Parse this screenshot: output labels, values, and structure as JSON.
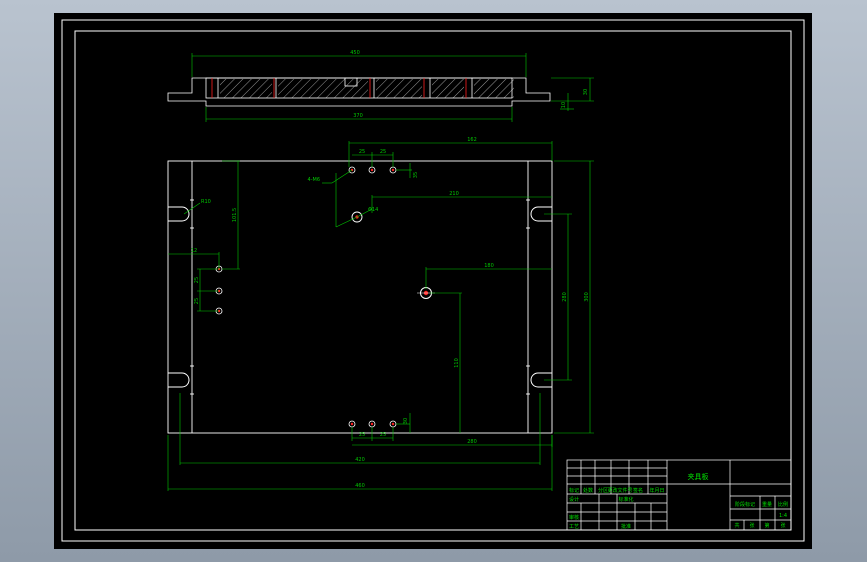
{
  "colors": {
    "background": "#000000",
    "frame": "#ffffff",
    "dimension": "#00c800",
    "hole_mark": "#ff2020",
    "hatch": "#ffffff"
  },
  "section_view": {
    "dims": {
      "overall_width": "450",
      "inner_width": "370",
      "thickness": "30",
      "step_height": "10"
    }
  },
  "plan_view": {
    "dims": {
      "top_span": "162",
      "pitch_a": "25",
      "pitch_b": "25",
      "hole_spec_left": "4-M6",
      "top_right_offset": "35",
      "mid_span": "210",
      "small_hole": "Φ14",
      "right_height_a": "280",
      "right_height_b": "300",
      "left_offset_v": "101.5",
      "corner_radius": "R10",
      "left_gap": "12",
      "left_pitch_a": "25",
      "left_pitch_b": "25",
      "center_offset_h": "180",
      "center_offset_v": "110",
      "bottom_pitch_a": "25",
      "bottom_pitch_b": "25",
      "bottom_right_dim": "30",
      "bottom_span": "280",
      "inner_width": "420",
      "overall_width": "460"
    }
  },
  "title_block": {
    "part_name": "夹具板",
    "scale": "1:4",
    "labels": {
      "revision": "标记",
      "count": "处数",
      "zone": "分区",
      "change_doc": "更改文件号",
      "sign": "签名",
      "date": "年月日",
      "designer": "设计",
      "standardize": "标准化",
      "review": "审核",
      "process": "工艺",
      "approve": "批准",
      "stage_mark": "阶段标记",
      "weight": "重量",
      "scale_label": "比例",
      "sheet_total": "共",
      "sheet_no": "张",
      "sheet_of": "第",
      "sheet_unit": "张"
    }
  }
}
